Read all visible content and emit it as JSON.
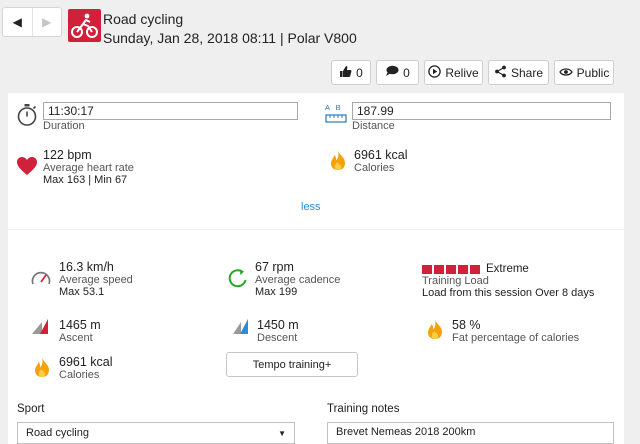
{
  "header": {
    "title": "Road cycling",
    "subtitle": "Sunday, Jan 28, 2018 08:11 | Polar V800",
    "accent_color": "#d1203a"
  },
  "nav": {
    "back_icon": "chevron-left-icon",
    "forward_icon": "chevron-right-icon"
  },
  "actions": {
    "like_count": "0",
    "comment_count": "0",
    "relive_label": "Relive",
    "share_label": "Share",
    "public_label": "Public"
  },
  "summary": {
    "duration_value": "11:30:17",
    "duration_label": "Duration",
    "distance_unit_icon": "A B",
    "distance_value": "187.99",
    "distance_label": "Distance",
    "hr_value": "122 bpm",
    "hr_label": "Average heart rate",
    "hr_minmax": "Max 163  |  Min 67",
    "calories_value": "6961 kcal",
    "calories_label": "Calories",
    "less_link": "less"
  },
  "details": {
    "speed_value": "16.3 km/h",
    "speed_label": "Average speed",
    "speed_max": "Max 53.1",
    "cadence_value": "67 rpm",
    "cadence_label": "Average cadence",
    "cadence_max": "Max 199",
    "load_level": "Extreme",
    "load_label": "Training Load",
    "load_recovery": "Load from this session Over 8 days",
    "ascent_value": "1465 m",
    "ascent_label": "Ascent",
    "descent_value": "1450 m",
    "descent_label": "Descent",
    "fat_value": "58 %",
    "fat_label": "Fat percentage of calories",
    "calories_value": "6961 kcal",
    "calories_label": "Calories",
    "tempo_button": "Tempo training+"
  },
  "form": {
    "sport_label": "Sport",
    "sport_value": "Road cycling",
    "notes_label": "Training notes",
    "notes_value": "Brevet Nemeas 2018 200km"
  }
}
